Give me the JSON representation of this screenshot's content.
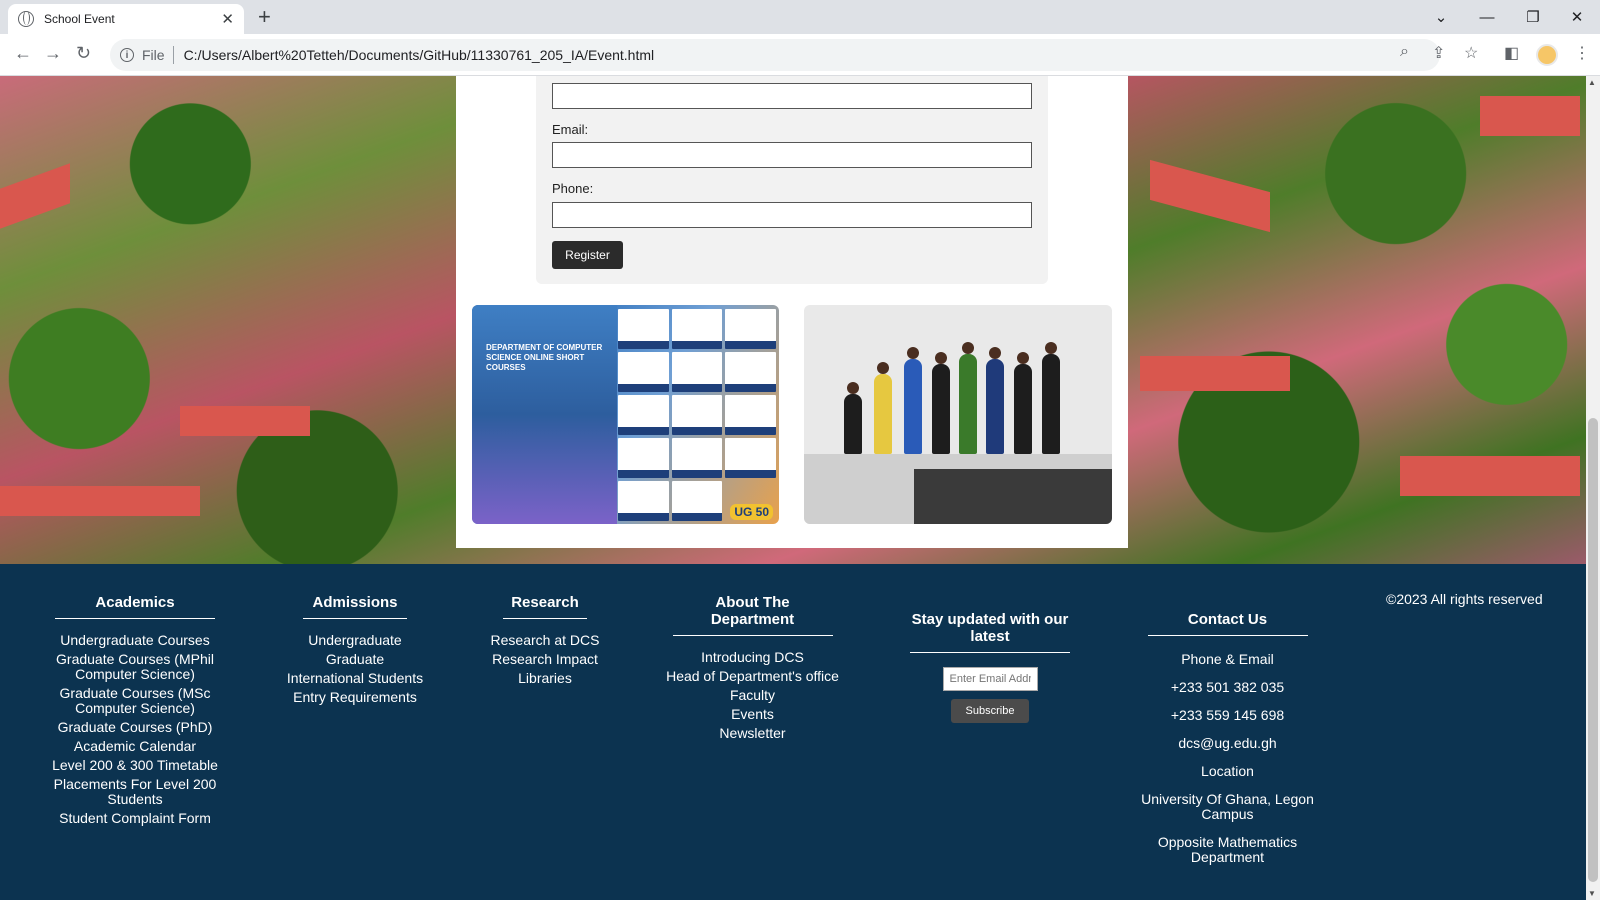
{
  "browser": {
    "tab_title": "School Event",
    "tab_close": "✕",
    "new_tab": "+",
    "file_label": "File",
    "url": "C:/Users/Albert%20Tetteh/Documents/GitHub/11330761_205_IA/Event.html"
  },
  "form": {
    "email_label": "Email:",
    "phone_label": "Phone:",
    "register_label": "Register"
  },
  "poster": {
    "title": "DEPARTMENT OF COMPUTER SCIENCE ONLINE SHORT COURSES",
    "badge": "UG 50"
  },
  "footer": {
    "academics": {
      "heading": "Academics",
      "links": [
        "Undergraduate Courses",
        "Graduate Courses (MPhil Computer Science)",
        "Graduate Courses (MSc Computer Science)",
        "Graduate Courses (PhD)",
        "Academic Calendar",
        "Level 200 & 300 Timetable",
        "Placements For Level 200 Students",
        "Student Complaint Form"
      ]
    },
    "admissions": {
      "heading": "Admissions",
      "links": [
        "Undergraduate",
        "Graduate",
        "International Students",
        "Entry Requirements"
      ]
    },
    "research": {
      "heading": "Research",
      "links": [
        "Research at DCS",
        "Research Impact",
        "Libraries"
      ]
    },
    "about": {
      "heading": "About The Department",
      "links": [
        "Introducing DCS",
        "Head of Department's office",
        "Faculty",
        "Events",
        "Newsletter"
      ]
    },
    "newsletter": {
      "heading": "Stay updated with our latest",
      "placeholder": "Enter Email Address",
      "subscribe_label": "Subscribe"
    },
    "contact": {
      "heading": "Contact Us",
      "items": [
        "Phone & Email",
        "+233 501 382 035",
        "+233 559 145 698",
        "dcs@ug.edu.gh",
        "Location",
        "University Of Ghana, Legon Campus",
        "Opposite Mathematics Department"
      ]
    },
    "copyright": "©2023 All rights reserved"
  },
  "colors": {
    "footer_bg": "#0c3350",
    "register_bg": "#2b2b2b"
  }
}
